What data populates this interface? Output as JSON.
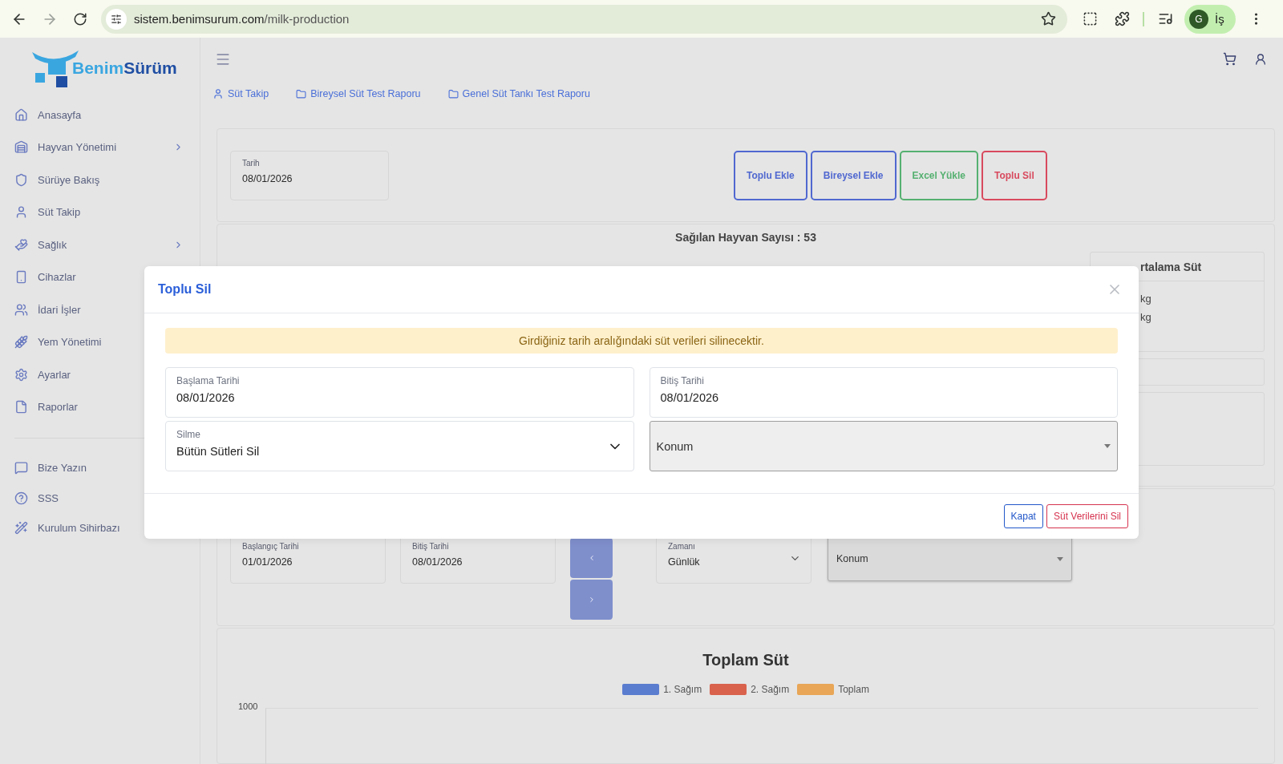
{
  "browser": {
    "url_host": "sistem.benimsurum.com",
    "url_path": "/milk-production",
    "profile_initial": "G",
    "profile_name": "İş"
  },
  "app": {
    "logo": {
      "first": "Benim",
      "second": "Sürüm"
    },
    "sidebar": {
      "items": [
        {
          "label": "Anasayfa",
          "expandable": false
        },
        {
          "label": "Hayvan Yönetimi",
          "expandable": true
        },
        {
          "label": "Sürüye Bakış",
          "expandable": false
        },
        {
          "label": "Süt Takip",
          "expandable": false
        },
        {
          "label": "Sağlık",
          "expandable": true
        },
        {
          "label": "Cihazlar",
          "expandable": false
        },
        {
          "label": "İdari İşler",
          "expandable": false
        },
        {
          "label": "Yem Yönetimi",
          "expandable": false
        },
        {
          "label": "Ayarlar",
          "expandable": false
        },
        {
          "label": "Raporlar",
          "expandable": false
        }
      ],
      "footer_items": [
        {
          "label": "Bize Yazın"
        },
        {
          "label": "SSS"
        },
        {
          "label": "Kurulum Sihirbazı"
        }
      ]
    },
    "breadcrumbs": [
      {
        "label": "Süt Takip"
      },
      {
        "label": "Bireysel Süt Test Raporu"
      },
      {
        "label": "Genel Süt Tankı Test Raporu"
      }
    ],
    "date_field": {
      "label": "Tarih",
      "value": "08/01/2026"
    },
    "actions": [
      {
        "label": "Toplu Ekle",
        "color": "#5068d0"
      },
      {
        "label": "Bireysel Ekle",
        "color": "#5068d0"
      },
      {
        "label": "Excel Yükle",
        "color": "#55b070"
      },
      {
        "label": "Toplu Sil",
        "color": "#d84a5e"
      }
    ],
    "milked_count": "Sağılan Hayvan Sayısı : 53",
    "average_card": {
      "title": "rtalama Süt",
      "rows": [
        "kg",
        "kg"
      ]
    },
    "filters": {
      "start": {
        "label": "Başlangıç Tarihi",
        "value": "01/01/2026"
      },
      "end": {
        "label": "Bitiş Tarihi",
        "value": "08/01/2026"
      },
      "period": {
        "label": "Zamanı",
        "value": "Günlük"
      },
      "location": {
        "placeholder": "Konum"
      }
    },
    "chart": {
      "title": "Toplam Süt",
      "legend": [
        {
          "label": "1. Sağım",
          "color": "#5b7dd0"
        },
        {
          "label": "2. Sağım",
          "color": "#d9624d"
        },
        {
          "label": "Toplam",
          "color": "#e8a656"
        }
      ],
      "y_tick": "1000"
    }
  },
  "modal": {
    "title": "Toplu Sil",
    "alert": "Girdiğiniz tarih aralığındaki süt verileri silinecektir.",
    "start": {
      "label": "Başlama Tarihi",
      "value": "08/01/2026"
    },
    "end": {
      "label": "Bitiş Tarihi",
      "value": "08/01/2026"
    },
    "mode": {
      "label": "Silme",
      "value": "Bütün Sütleri Sil"
    },
    "location": {
      "placeholder": "Konum"
    },
    "buttons": [
      {
        "label": "Kapat",
        "kind": "secondary"
      },
      {
        "label": "Süt Verilerini Sil",
        "kind": "danger"
      }
    ]
  }
}
